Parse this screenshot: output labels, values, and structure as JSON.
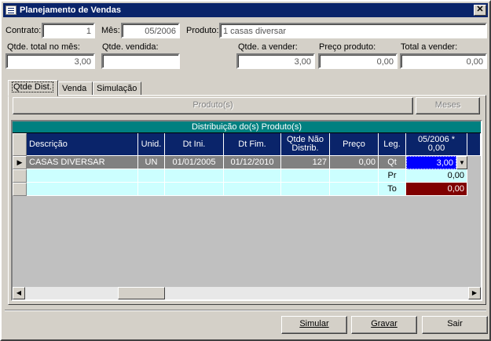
{
  "window": {
    "title": "Planejamento de Vendas",
    "close_glyph": "✕"
  },
  "header": {
    "contrato_label": "Contrato:",
    "contrato_value": "1",
    "mes_label": "Mês:",
    "mes_value": "05/2006",
    "produto_label": "Produto:",
    "produto_value": "1 casas diversar",
    "qtde_total_label": "Qtde. total no mês:",
    "qtde_total_value": "3,00",
    "qtde_vendida_label": "Qtde. vendida:",
    "qtde_vendida_value": "",
    "qtde_vender_label": "Qtde. a vender:",
    "qtde_vender_value": "3,00",
    "preco_produto_label": "Preço produto:",
    "preco_produto_value": "0,00",
    "total_vender_label": "Total a vender:",
    "total_vender_value": "0,00"
  },
  "tabs": [
    {
      "label": "Qtde Dist."
    },
    {
      "label": "Venda"
    },
    {
      "label": "Simulação"
    }
  ],
  "panel": {
    "produtos_button": "Produto(s)",
    "meses_button": "Meses"
  },
  "grid": {
    "caption": "Distribuição do(s) Produto(s)",
    "columns": [
      "Descrição",
      "Unid.",
      "Dt Ini.",
      "Dt Fim.",
      "Qtde Não Distrib.",
      "Preço",
      "Leg.",
      "05/2006  *\n0,00"
    ],
    "rows": [
      {
        "descricao": "CASAS DIVERSAR",
        "unid": "UN",
        "dt_ini": "01/01/2005",
        "dt_fim": "01/12/2010",
        "qtde": "127",
        "preco": "0,00",
        "leg": "Qt",
        "value": "3,00"
      },
      {
        "leg": "Pr",
        "value": "0,00"
      },
      {
        "leg": "To",
        "value": "0,00"
      }
    ],
    "colors": {
      "header_bg": "#0a246a",
      "caption_bg": "#008080",
      "selected_row_bg": "#808080",
      "empty_row_bg": "#ccffff",
      "to_cell_bg": "#800000",
      "edit_cell_bg": "#0000ff"
    }
  },
  "footer": {
    "simular": "Simular",
    "gravar": "Gravar",
    "sair": "Sair"
  }
}
